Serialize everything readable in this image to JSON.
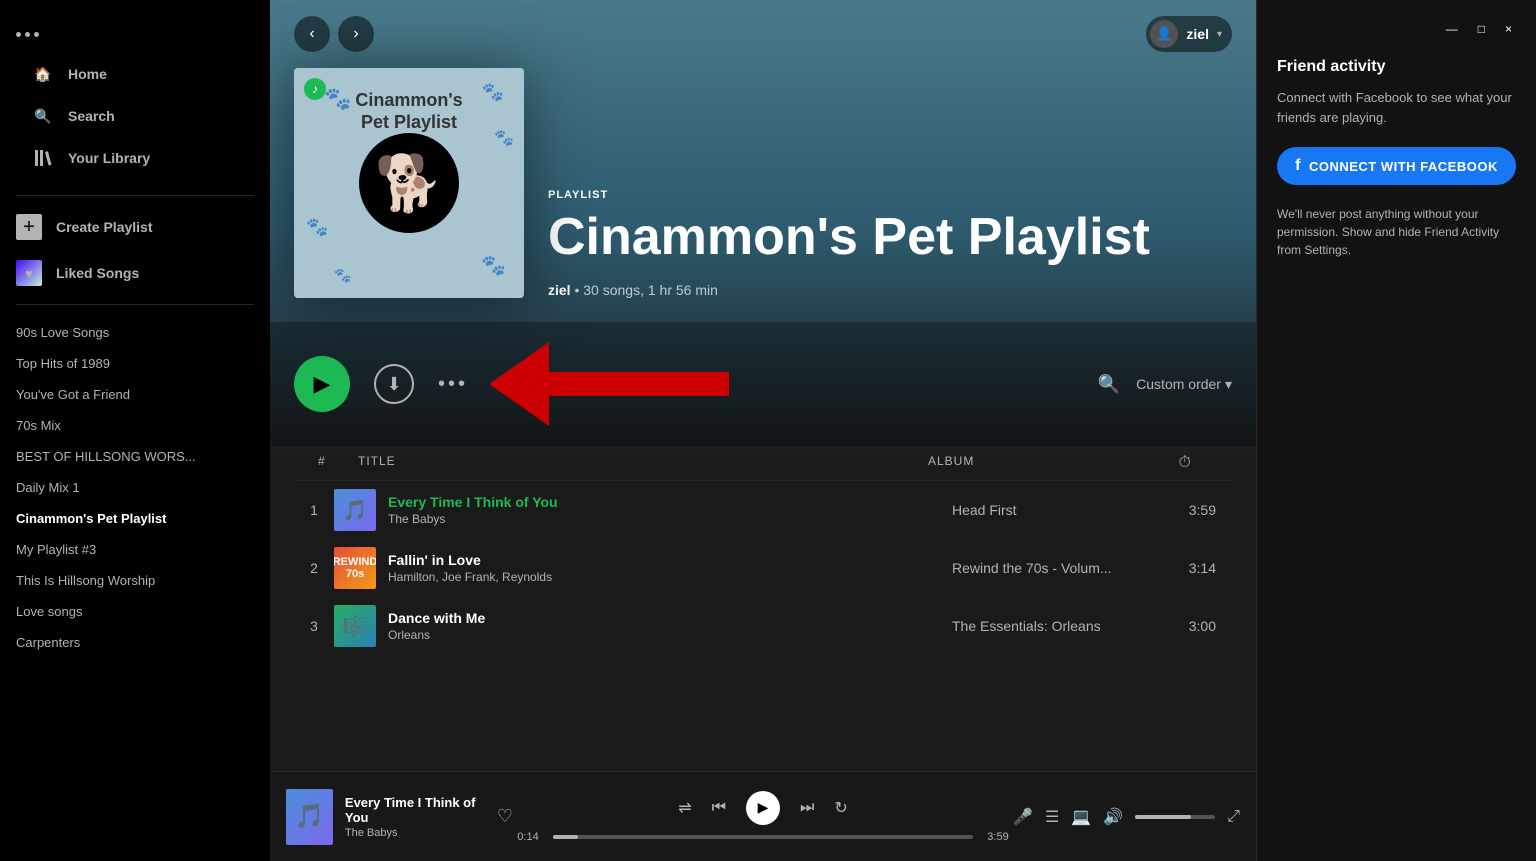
{
  "window": {
    "minimize": "—",
    "restore": "□",
    "close": "×"
  },
  "sidebar": {
    "menu_dots": [
      "•",
      "•",
      "•"
    ],
    "nav_items": [
      {
        "id": "home",
        "label": "Home",
        "icon": "🏠"
      },
      {
        "id": "search",
        "label": "Search",
        "icon": "🔍"
      },
      {
        "id": "library",
        "label": "Your Library",
        "icon": "📚"
      }
    ],
    "create_playlist_label": "Create Playlist",
    "liked_songs_label": "Liked Songs",
    "playlists": [
      {
        "id": "90s-love",
        "label": "90s Love Songs",
        "active": false
      },
      {
        "id": "top-hits-1989",
        "label": "Top Hits of 1989",
        "active": false
      },
      {
        "id": "youve-got-friend",
        "label": "You've Got a Friend",
        "active": false
      },
      {
        "id": "70s-mix",
        "label": "70s Mix",
        "active": false
      },
      {
        "id": "best-hillsong",
        "label": "BEST OF HILLSONG WORS...",
        "active": false
      },
      {
        "id": "daily-mix-1",
        "label": "Daily Mix 1",
        "active": false
      },
      {
        "id": "cinammons-pet",
        "label": "Cinammon's Pet Playlist",
        "active": true
      },
      {
        "id": "my-playlist-3",
        "label": "My Playlist #3",
        "active": false
      },
      {
        "id": "this-is-hillsong",
        "label": "This Is Hillsong Worship",
        "active": false
      },
      {
        "id": "love-songs",
        "label": "Love songs",
        "active": false
      },
      {
        "id": "carpenters",
        "label": "Carpenters",
        "active": false
      }
    ]
  },
  "topbar": {
    "user_name": "ziel",
    "user_icon": "👤"
  },
  "playlist": {
    "type_label": "PLAYLIST",
    "title": "Cinammon's Pet Playlist",
    "owner": "ziel",
    "song_count": "30 songs",
    "duration": "1 hr 56 min",
    "cover_title": "Cinammon's Pet Playlist",
    "cover_emoji": "🐶"
  },
  "controls": {
    "play_label": "▶",
    "download_label": "⬇",
    "more_label": "•••",
    "search_label": "🔍",
    "order_label": "Custom order",
    "order_chevron": "▾"
  },
  "track_list": {
    "headers": {
      "num": "#",
      "title": "TITLE",
      "album": "ALBUM",
      "duration_icon": "⏱"
    },
    "tracks": [
      {
        "num": "1",
        "title": "Every Time I Think of You",
        "artist": "The Babys",
        "album": "Head First",
        "duration": "3:59",
        "active": true
      },
      {
        "num": "2",
        "title": "Fallin' in Love",
        "artist": "Hamilton, Joe Frank, Reynolds",
        "album": "Rewind the 70s - Volum...",
        "duration": "3:14",
        "active": false
      },
      {
        "num": "3",
        "title": "Dance with Me",
        "artist": "Orleans",
        "album": "The Essentials: Orleans",
        "duration": "3:00",
        "active": false
      }
    ]
  },
  "friend_activity": {
    "title": "Friend activity",
    "description": "Connect with Facebook to see what your friends are playing.",
    "connect_label": "CONNECT WITH FACEBOOK",
    "note": "We'll never post anything without your permission. Show and hide Friend Activity from Settings."
  },
  "player": {
    "now_playing_title": "Every Time I Think of You",
    "now_playing_artist": "The Babys",
    "current_time": "0:14",
    "total_time": "3:59",
    "progress_pct": 6
  }
}
